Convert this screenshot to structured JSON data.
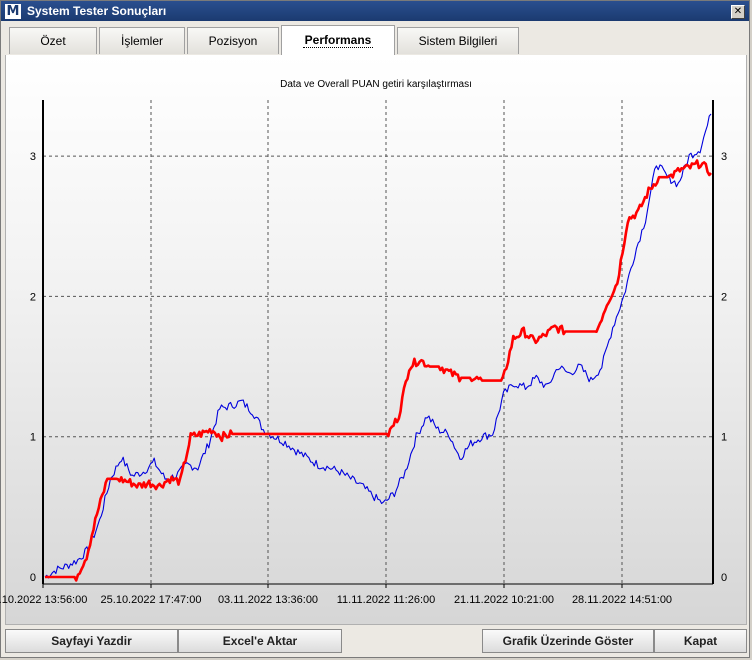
{
  "window": {
    "title": "System Tester Sonuçları",
    "app_icon": "M",
    "close_glyph": "✕"
  },
  "tabs": [
    {
      "label": "Özet",
      "active": false
    },
    {
      "label": "İşlemler",
      "active": false
    },
    {
      "label": "Pozisyon",
      "active": false
    },
    {
      "label": "Performans",
      "active": true
    },
    {
      "label": "Sistem Bilgileri",
      "active": false
    }
  ],
  "footer": {
    "print_label": "Sayfayi Yazdir",
    "excel_label": "Excel'e Aktar",
    "show_on_chart_label": "Grafik Üzerinde Göster",
    "close_label": "Kapat"
  },
  "chart_data": {
    "type": "line",
    "title": "Data ve Overall PUAN getiri karşılaştırması",
    "x_ticks": [
      ".10.2022 13:56:00",
      "25.10.2022 17:47:00",
      "03.11.2022 13:36:00",
      "11.11.2022 11:26:00",
      "21.11.2022 10:21:00",
      "28.11.2022 14:51:00"
    ],
    "y_ticks": [
      "0",
      "1",
      "2",
      "3"
    ],
    "ylim": [
      -0.05,
      3.4
    ],
    "grid": true,
    "series": [
      {
        "color": "#0000dd",
        "values": [
          0.0,
          0.05,
          0.08,
          0.12,
          0.2,
          0.4,
          0.7,
          0.85,
          0.72,
          0.75,
          0.82,
          0.7,
          0.72,
          0.8,
          0.78,
          0.95,
          1.2,
          1.22,
          1.25,
          1.18,
          1.05,
          1.0,
          0.96,
          0.9,
          0.85,
          0.8,
          0.78,
          0.75,
          0.7,
          0.65,
          0.58,
          0.52,
          0.6,
          0.75,
          1.0,
          1.15,
          1.05,
          1.02,
          0.85,
          0.95,
          1.0,
          1.02,
          1.3,
          1.38,
          1.35,
          1.42,
          1.35,
          1.5,
          1.45,
          1.5,
          1.4,
          1.5,
          1.78,
          2.0,
          2.3,
          2.55,
          2.95,
          2.85,
          2.8,
          3.0,
          3.05,
          3.3
        ]
      },
      {
        "color": "#ff0000",
        "values": [
          0.0,
          0.0,
          0.0,
          0.0,
          0.15,
          0.45,
          0.7,
          0.7,
          0.68,
          0.65,
          0.67,
          0.65,
          0.7,
          0.68,
          1.0,
          1.02,
          1.05,
          1.0,
          1.02,
          1.02,
          1.02,
          1.02,
          1.02,
          1.02,
          1.02,
          1.02,
          1.02,
          1.02,
          1.02,
          1.02,
          1.02,
          1.02,
          1.02,
          1.02,
          1.15,
          1.5,
          1.55,
          1.5,
          1.5,
          1.45,
          1.42,
          1.42,
          1.4,
          1.4,
          1.4,
          1.7,
          1.75,
          1.68,
          1.72,
          1.78,
          1.75,
          1.75,
          1.75,
          1.75,
          1.95,
          2.1,
          2.55,
          2.6,
          2.75,
          2.85,
          2.85,
          2.9,
          2.92,
          2.95,
          2.88
        ]
      }
    ]
  }
}
